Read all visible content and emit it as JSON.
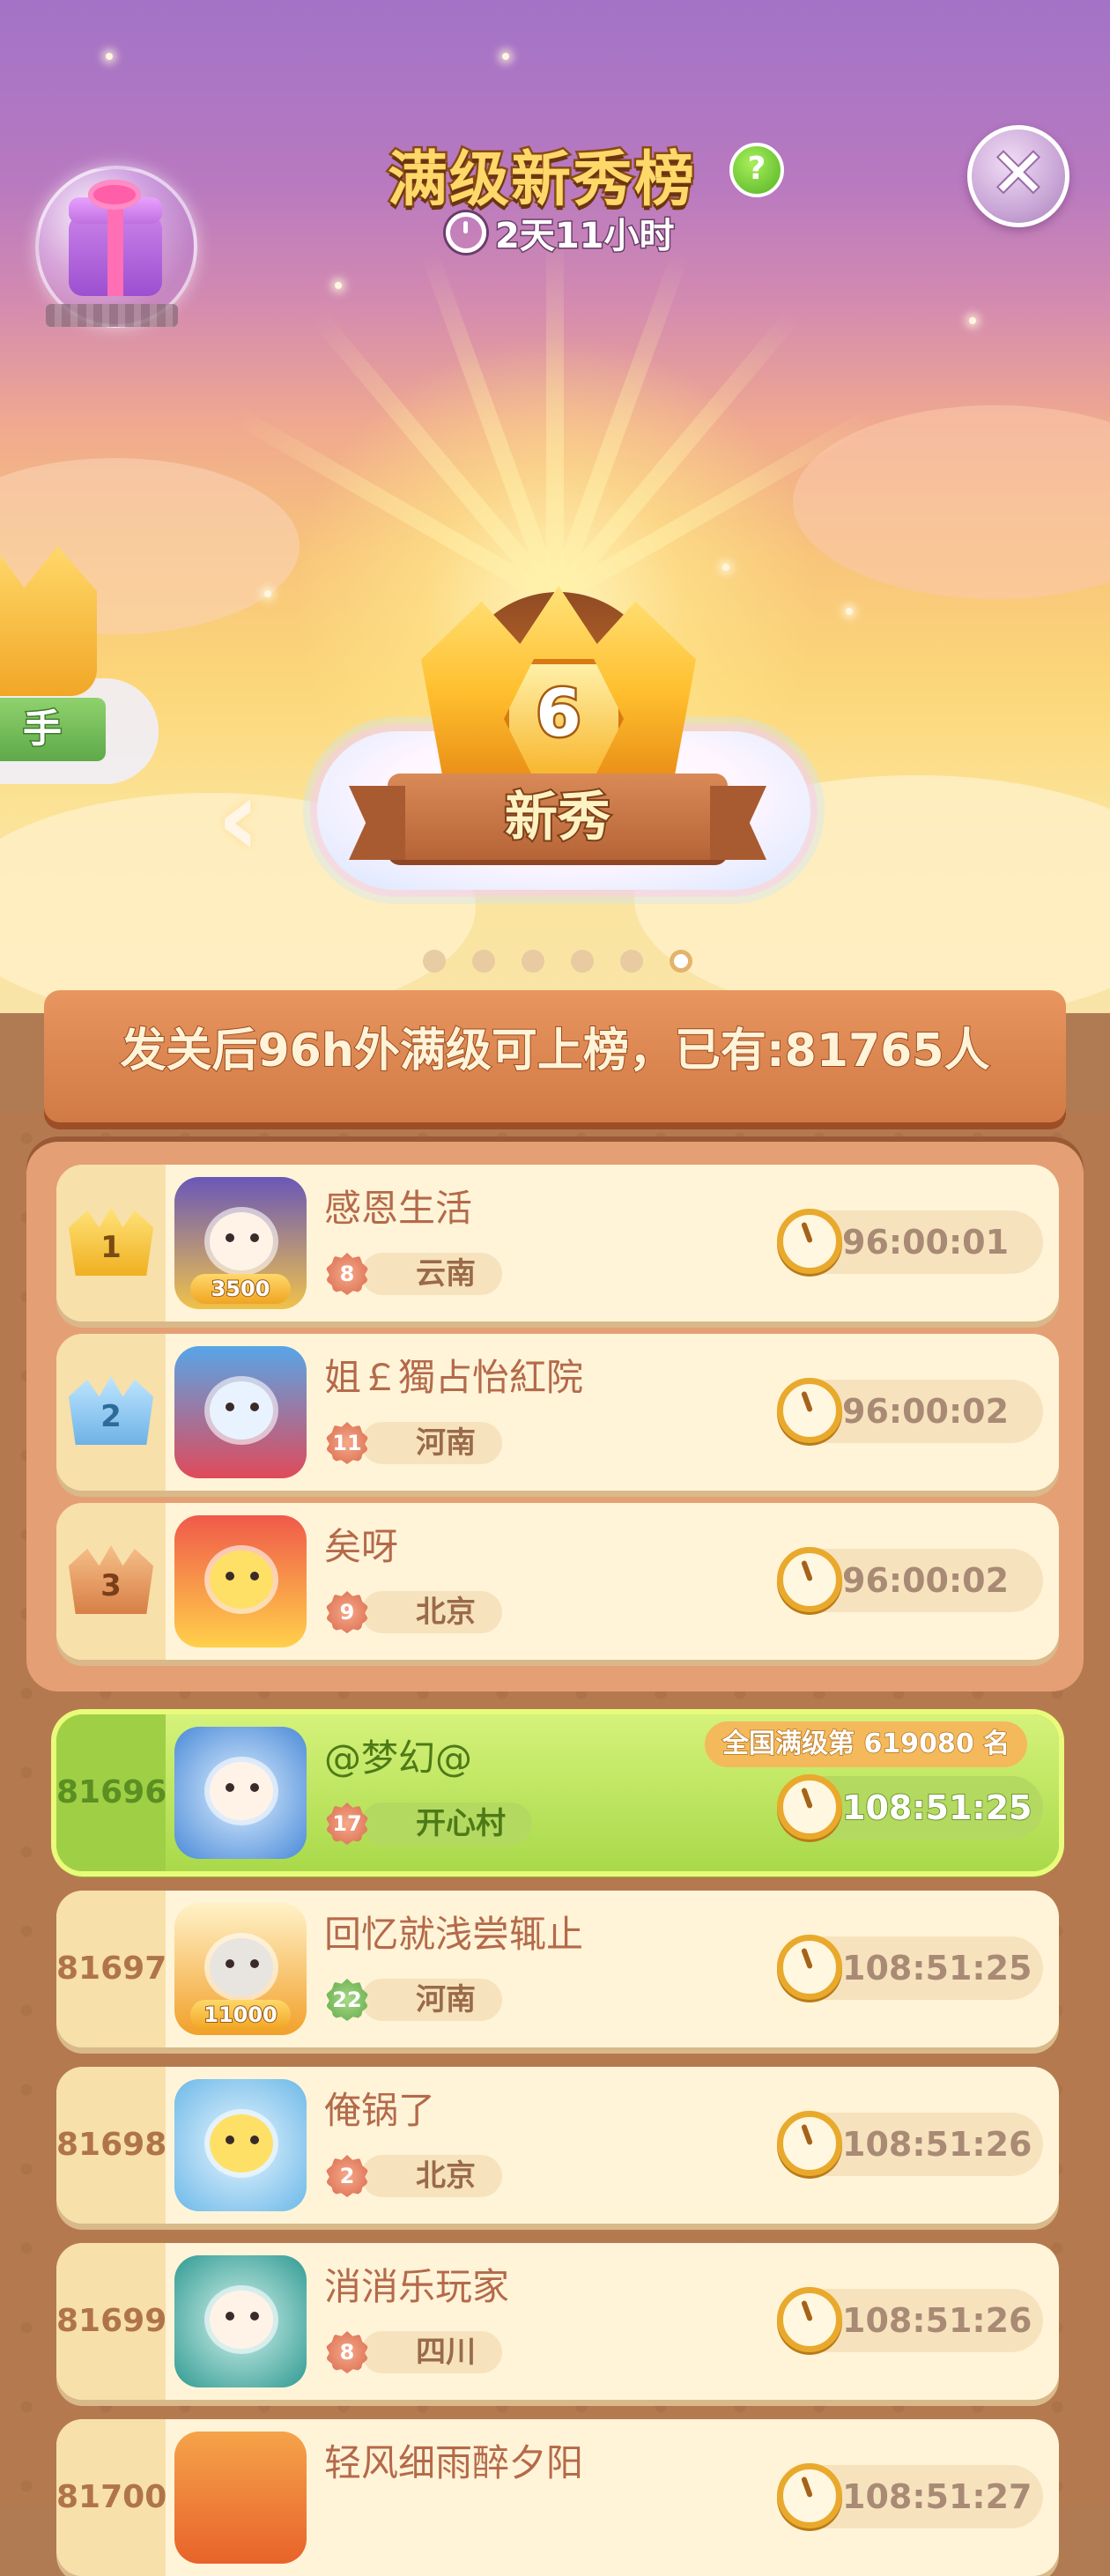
{
  "header": {
    "title": "满级新秀榜",
    "help_label": "?",
    "countdown": "2天11小时",
    "close_label": "✕"
  },
  "tier_carousel": {
    "prev_arrow": "‹",
    "side_label": "手",
    "current_level": "6",
    "current_label": "新秀",
    "page_count": 6,
    "active_page": 6
  },
  "banner": {
    "text": "发关后96h外满级可上榜，已有:81765人"
  },
  "top3": [
    {
      "rank": "1",
      "name": "感恩生活",
      "level": "8",
      "place": "云南",
      "time": "96:00:01",
      "avatar_tag": "3500"
    },
    {
      "rank": "2",
      "name": "姐￡獨占怡紅院",
      "level": "11",
      "place": "河南",
      "time": "96:00:02",
      "avatar_tag": ""
    },
    {
      "rank": "3",
      "name": "矣呀",
      "level": "9",
      "place": "北京",
      "time": "96:00:02",
      "avatar_tag": ""
    }
  ],
  "me": {
    "rank": "81696",
    "name": "@梦幻@",
    "level": "17",
    "place": "开心村",
    "time": "108:51:25",
    "national_rank_label": "全国满级第 619080 名"
  },
  "rows": [
    {
      "rank": "81697",
      "name": "回忆就浅尝辄止",
      "level": "22",
      "place": "河南",
      "time": "108:51:25",
      "avatar_tag": "11000"
    },
    {
      "rank": "81698",
      "name": "俺锅了",
      "level": "2",
      "place": "北京",
      "time": "108:51:26",
      "avatar_tag": ""
    },
    {
      "rank": "81699",
      "name": "消消乐玩家",
      "level": "8",
      "place": "四川",
      "time": "108:51:26",
      "avatar_tag": ""
    },
    {
      "rank": "81700",
      "name": "轻风细雨醉夕阳",
      "level": "",
      "place": "",
      "time": "108:51:27",
      "avatar_tag": ""
    }
  ],
  "colors": {
    "gold_crown": "#f5c436",
    "silver_crown": "#8ec8ee",
    "bronze_crown": "#e39b62",
    "highlight_row": "#c6e866"
  }
}
